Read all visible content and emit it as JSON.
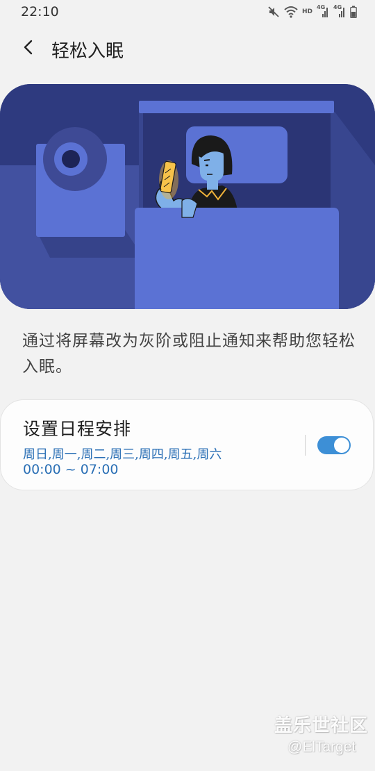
{
  "status_bar": {
    "time": "22:10",
    "hd_label": "HD",
    "network_label_1": "4G",
    "network_label_2": "4G",
    "icons": [
      "mute-icon",
      "wifi-icon",
      "signal-icon",
      "signal-icon",
      "battery-icon"
    ]
  },
  "header": {
    "back_icon": "chevron-left-icon",
    "title": "轻松入眠"
  },
  "illustration": {
    "description_icon": "bedtime-illustration"
  },
  "description": "通过将屏幕改为灰阶或阻止通知来帮助您轻松入眠。",
  "schedule": {
    "title": "设置日程安排",
    "days": "周日,周一,周二,周三,周四,周五,周六",
    "time_range": "00:00 ~ 07:00",
    "enabled": true
  },
  "watermark": {
    "brand": "盖乐世社区",
    "user": "@ElTarget"
  },
  "colors": {
    "background": "#f2f2f2",
    "accent": "#3d8fd6",
    "schedule_text": "#2a6fb5",
    "illustration_dark": "#2f3a7e",
    "illustration_light": "#5b72d4"
  }
}
